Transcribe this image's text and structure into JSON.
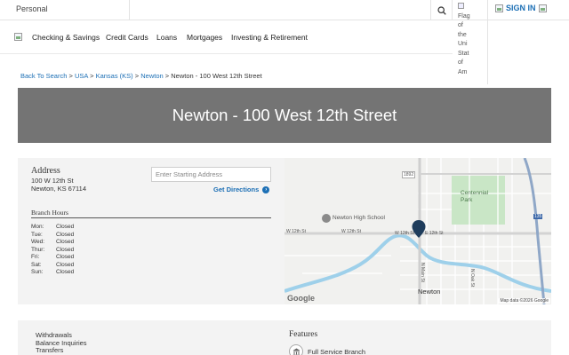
{
  "topbar": {
    "personal_label": "Personal",
    "flag_alt_words": [
      "Flag",
      "of",
      "the",
      "Uni",
      "Stat",
      "of",
      "Am"
    ],
    "signin_label": "SIGN IN"
  },
  "nav": {
    "items": [
      "Checking & Savings",
      "Credit Cards",
      "Loans",
      "Mortgages",
      "Investing & Retirement"
    ]
  },
  "breadcrumb": {
    "links": [
      "Back To Search",
      "USA",
      "Kansas (KS)",
      "Newton"
    ],
    "separator": ">",
    "current": "Newton - 100 West 12th Street"
  },
  "hero": {
    "title": "Newton - 100 West 12th Street"
  },
  "address": {
    "title": "Address",
    "line1": "100 W 12th St",
    "line2": "Newton, KS 67114"
  },
  "directions": {
    "placeholder": "Enter Starting Address",
    "link_label": "Get Directions",
    "link_icon": "chevron-right-icon"
  },
  "hours": {
    "title": "Branch Hours",
    "rows": [
      {
        "day": "Mon:",
        "status": "Closed"
      },
      {
        "day": "Tue:",
        "status": "Closed"
      },
      {
        "day": "Wed:",
        "status": "Closed"
      },
      {
        "day": "Thur:",
        "status": "Closed"
      },
      {
        "day": "Fri:",
        "status": "Closed"
      },
      {
        "day": "Sat:",
        "status": "Closed"
      },
      {
        "day": "Sun:",
        "status": "Closed"
      }
    ]
  },
  "map": {
    "labels": {
      "centennial": "Centennial Park",
      "school": "Newton High School",
      "city": "Newton",
      "w12_left": "W 12th St",
      "w12_mid": "W 12th St",
      "e12": "E 12th St",
      "w12_pin": "W 12th St",
      "route": "1892",
      "hwy": "135",
      "main_st": "N Main St",
      "n_st": "N Oak St"
    },
    "google_logo": "Google",
    "attribution": "Map data ©2026 Google",
    "colors": {
      "road": "#ffffff",
      "river": "#9ed0ea",
      "park": "#c9e6c6",
      "pin": "#1f3d5c"
    }
  },
  "services": {
    "items": [
      "Withdrawals",
      "Balance Inquiries",
      "Transfers"
    ],
    "features_title": "Features",
    "features": [
      {
        "label": "Full Service Branch",
        "icon": "bank-building-icon"
      }
    ]
  }
}
